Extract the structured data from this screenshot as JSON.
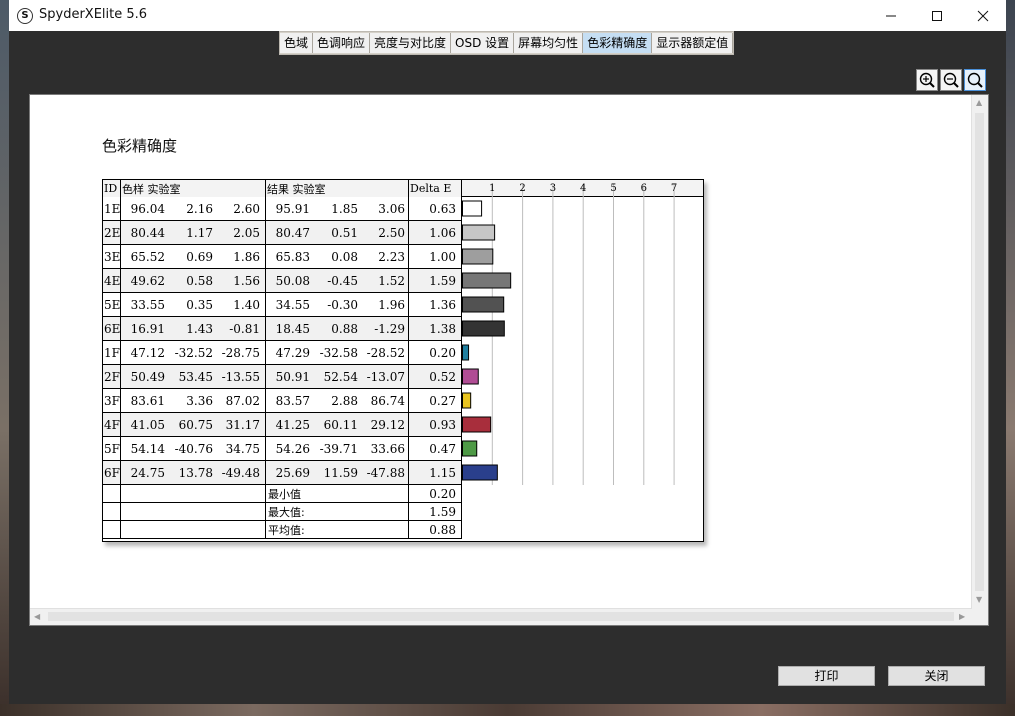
{
  "window": {
    "title": "SpyderXElite 5.6",
    "app_icon": "S"
  },
  "tabs": [
    {
      "label": "色域",
      "active": false
    },
    {
      "label": "色调响应",
      "active": false
    },
    {
      "label": "亮度与对比度",
      "active": false
    },
    {
      "label": "OSD 设置",
      "active": false
    },
    {
      "label": "屏幕均匀性",
      "active": false
    },
    {
      "label": "色彩精确度",
      "active": true
    },
    {
      "label": "显示器额定值",
      "active": false
    }
  ],
  "zoom_icons": [
    "zoom-in-icon",
    "zoom-out-icon",
    "zoom-fit-icon"
  ],
  "report": {
    "title": "色彩精确度",
    "headers": {
      "id": "ID",
      "sample": "色样 实验室",
      "result": "结果 实验室",
      "delta": "Delta E"
    },
    "rows": [
      {
        "id": "1E",
        "sample": [
          "96.04",
          "2.16",
          "2.60"
        ],
        "result": [
          "95.91",
          "1.85",
          "3.06"
        ],
        "delta": "0.63",
        "delta_value": 0.63,
        "color": "#ffffff"
      },
      {
        "id": "2E",
        "sample": [
          "80.44",
          "1.17",
          "2.05"
        ],
        "result": [
          "80.47",
          "0.51",
          "2.50"
        ],
        "delta": "1.06",
        "delta_value": 1.06,
        "color": "#c6c6c6"
      },
      {
        "id": "3E",
        "sample": [
          "65.52",
          "0.69",
          "1.86"
        ],
        "result": [
          "65.83",
          "0.08",
          "2.23"
        ],
        "delta": "1.00",
        "delta_value": 1.0,
        "color": "#9e9e9e"
      },
      {
        "id": "4E",
        "sample": [
          "49.62",
          "0.58",
          "1.56"
        ],
        "result": [
          "50.08",
          "-0.45",
          "1.52"
        ],
        "delta": "1.59",
        "delta_value": 1.59,
        "color": "#767676"
      },
      {
        "id": "5E",
        "sample": [
          "33.55",
          "0.35",
          "1.40"
        ],
        "result": [
          "34.55",
          "-0.30",
          "1.96"
        ],
        "delta": "1.36",
        "delta_value": 1.36,
        "color": "#525252"
      },
      {
        "id": "6E",
        "sample": [
          "16.91",
          "1.43",
          "-0.81"
        ],
        "result": [
          "18.45",
          "0.88",
          "-1.29"
        ],
        "delta": "1.38",
        "delta_value": 1.38,
        "color": "#333333"
      },
      {
        "id": "1F",
        "sample": [
          "47.12",
          "-32.52",
          "-28.75"
        ],
        "result": [
          "47.29",
          "-32.58",
          "-28.52"
        ],
        "delta": "0.20",
        "delta_value": 0.2,
        "color": "#1f7fa0"
      },
      {
        "id": "2F",
        "sample": [
          "50.49",
          "53.45",
          "-13.55"
        ],
        "result": [
          "50.91",
          "52.54",
          "-13.07"
        ],
        "delta": "0.52",
        "delta_value": 0.52,
        "color": "#b04c94"
      },
      {
        "id": "3F",
        "sample": [
          "83.61",
          "3.36",
          "87.02"
        ],
        "result": [
          "83.57",
          "2.88",
          "86.74"
        ],
        "delta": "0.27",
        "delta_value": 0.27,
        "color": "#e8c420"
      },
      {
        "id": "4F",
        "sample": [
          "41.05",
          "60.75",
          "31.17"
        ],
        "result": [
          "41.25",
          "60.11",
          "29.12"
        ],
        "delta": "0.93",
        "delta_value": 0.93,
        "color": "#a82e3c"
      },
      {
        "id": "5F",
        "sample": [
          "54.14",
          "-40.76",
          "34.75"
        ],
        "result": [
          "54.26",
          "-39.71",
          "33.66"
        ],
        "delta": "0.47",
        "delta_value": 0.47,
        "color": "#4e9a46"
      },
      {
        "id": "6F",
        "sample": [
          "24.75",
          "13.78",
          "-49.48"
        ],
        "result": [
          "25.69",
          "11.59",
          "-47.88"
        ],
        "delta": "1.15",
        "delta_value": 1.15,
        "color": "#2a3f8c"
      }
    ],
    "summary": [
      {
        "label": "最小值",
        "value": "0.20"
      },
      {
        "label": "最大值:",
        "value": "1.59"
      },
      {
        "label": "平均值:",
        "value": "0.88"
      }
    ],
    "axis_ticks": [
      "1",
      "2",
      "3",
      "4",
      "5",
      "6",
      "7"
    ],
    "axis_max": 8
  },
  "buttons": {
    "print": "打印",
    "close": "关闭"
  }
}
